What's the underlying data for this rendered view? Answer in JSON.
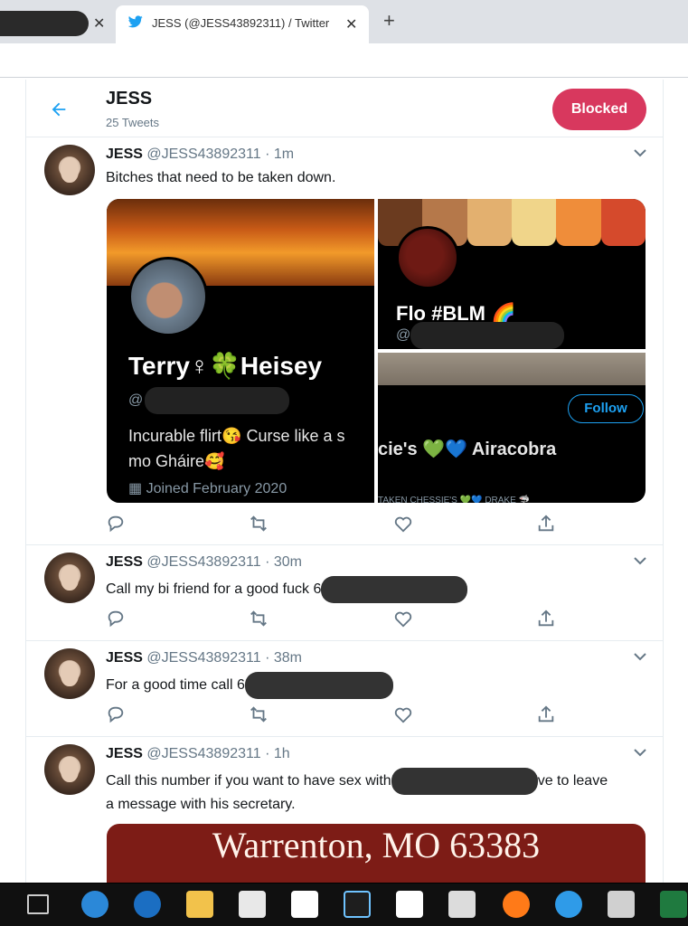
{
  "browser": {
    "prev_tab_close": "✕",
    "active_tab": {
      "title": "JESS (@JESS43892311) / Twitter",
      "close": "✕"
    },
    "new_tab": "+"
  },
  "profile_header": {
    "name": "JESS",
    "tweet_count": "25 Tweets",
    "blocked_label": "Blocked"
  },
  "tweets": [
    {
      "name": "JESS",
      "meta": "@JESS43892311 · 1m",
      "text": "Bitches that need to be taken down.",
      "media": {
        "left": {
          "name": "Terry♀🍀Heisey",
          "handle_prefix": "@",
          "bio_line1": "Incurable flirt😘 Curse like a s",
          "bio_line2": "mo Gháire🥰",
          "joined": "Joined February 2020"
        },
        "top_right": {
          "name": "Flo #BLM 🌈",
          "handle_prefix": "@"
        },
        "bottom_right": {
          "follow_label": "Follow",
          "name": "cie's 💚💙 Airacobra",
          "sub": "TAKEN   CHESSIE'S 💚💙 DRAKE 🦈"
        }
      }
    },
    {
      "name": "JESS",
      "meta": "@JESS43892311 · 30m",
      "text": "Call my bi friend for a good fuck 6"
    },
    {
      "name": "JESS",
      "meta": "@JESS43892311 · 38m",
      "text": "For a good time call 6"
    },
    {
      "name": "JESS",
      "meta": "@JESS43892311 · 1h",
      "text_a": "Call this number if you want to have sex with",
      "text_b": "ve to leave",
      "text_c": "a message with his secretary.",
      "image_text": "Warrenton, MO 63383"
    }
  ],
  "colors": {
    "accent": "#1da1f2",
    "blocked": "#d8385e",
    "muted": "#657786"
  }
}
